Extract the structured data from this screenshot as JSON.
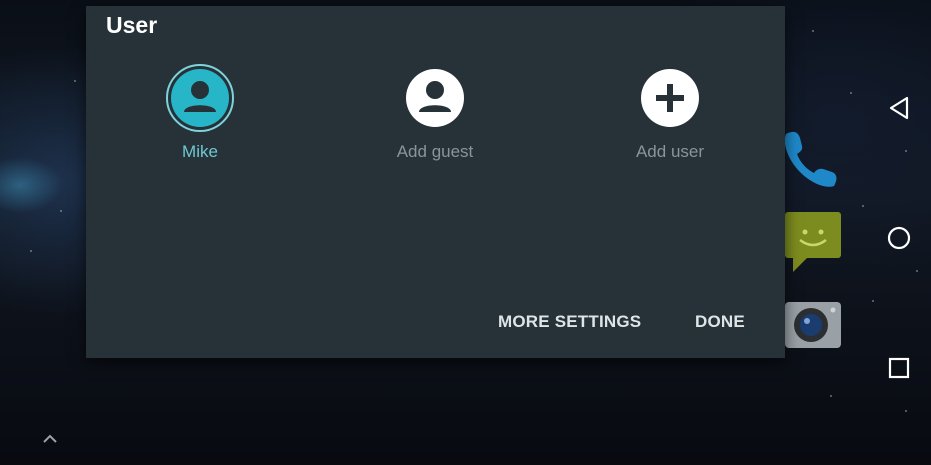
{
  "dialog": {
    "title": "User",
    "users": [
      {
        "label": "Mike",
        "icon": "person-avatar-icon",
        "active": true
      },
      {
        "label": "Add guest",
        "icon": "add-guest-icon",
        "active": false
      },
      {
        "label": "Add user",
        "icon": "plus-icon",
        "active": false
      }
    ],
    "more_settings_label": "MORE SETTINGS",
    "done_label": "DONE"
  },
  "colors": {
    "dialog_bg": "#263238",
    "accent": "#26b6c8",
    "active_label": "#6fc7d2",
    "inactive_label": "#8a9499"
  },
  "navigation_bar": {
    "icons": [
      "back-icon",
      "home-icon",
      "recents-icon"
    ]
  },
  "background": {
    "app_icons": [
      "phone-icon",
      "messaging-icon",
      "camera-icon"
    ],
    "launcher_icon": "chevron-up-icon"
  }
}
